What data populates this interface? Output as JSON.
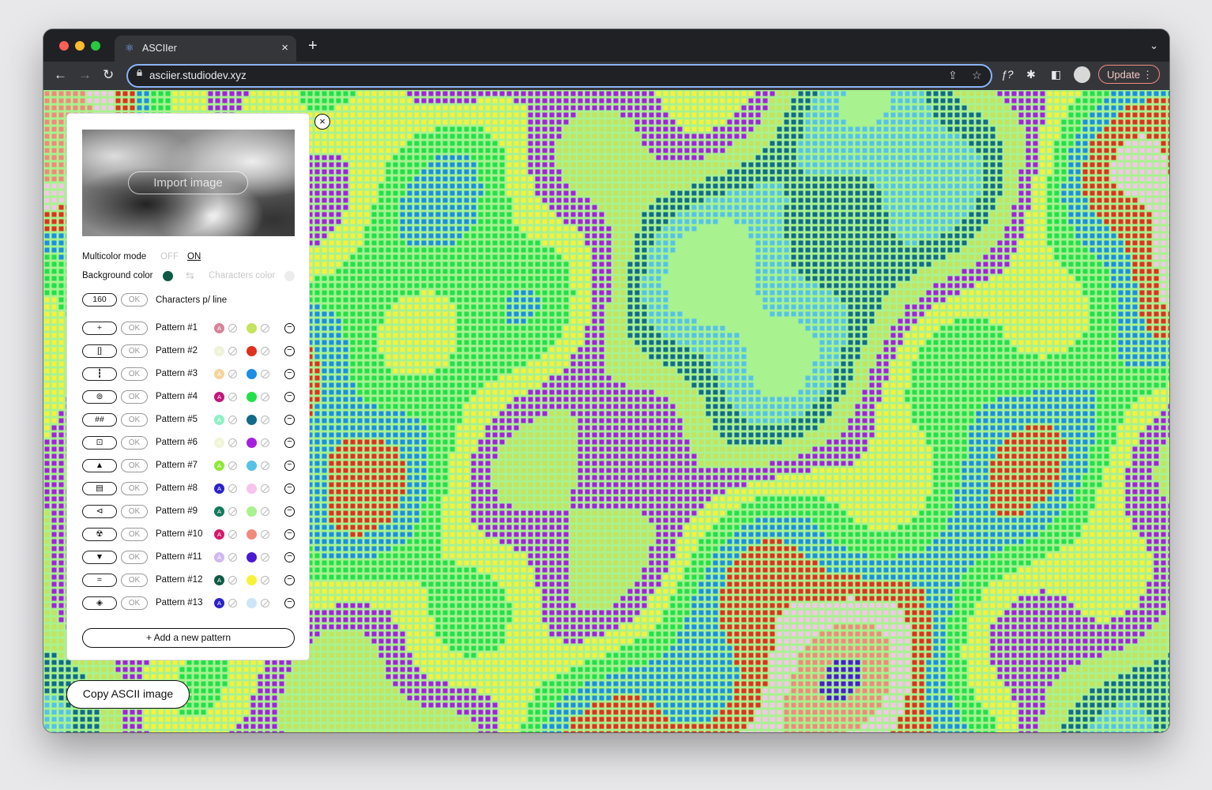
{
  "browser": {
    "tab_title": "ASCIIer",
    "url": "asciier.studiodev.xyz",
    "update_label": "Update",
    "new_tab": "+",
    "tab_close": "×"
  },
  "panel": {
    "import_label": "Import image",
    "multicolor_label": "Multicolor mode",
    "multicolor_off": "OFF",
    "multicolor_on": "ON",
    "background_label": "Background color",
    "background_color": "#0f5a45",
    "characters_color_label": "Characters color",
    "chars_per_line_value": "160",
    "ok_label": "OK",
    "chars_per_line_label": "Characters p/ line",
    "add_pattern_label": "+ Add a new pattern",
    "close_label": "×",
    "patterns": [
      {
        "char": "+",
        "name": "Pattern #1",
        "swatch_a": "#d4839b",
        "color": "#c5e35c"
      },
      {
        "char": "[]",
        "name": "Pattern #2",
        "swatch_a": "#eef2d6",
        "color": "#e0301e"
      },
      {
        "char": "┇",
        "name": "Pattern #3",
        "swatch_a": "#f5d49d",
        "color": "#1a8fe3"
      },
      {
        "char": "⊚",
        "name": "Pattern #4",
        "swatch_a": "#c2187a",
        "color": "#22e04a"
      },
      {
        "char": "##",
        "name": "Pattern #5",
        "swatch_a": "#8ef0c4",
        "color": "#126a8a"
      },
      {
        "char": "⊡",
        "name": "Pattern #6",
        "swatch_a": "#f0f5d5",
        "color": "#a51fe0"
      },
      {
        "char": "▲",
        "name": "Pattern #7",
        "swatch_a": "#8fe838",
        "color": "#55c2e8"
      },
      {
        "char": "▤",
        "name": "Pattern #8",
        "swatch_a": "#2a24c8",
        "color": "#f7c4ec"
      },
      {
        "char": "⊲",
        "name": "Pattern #9",
        "swatch_a": "#127a5a",
        "color": "#a8f290"
      },
      {
        "char": "☢",
        "name": "Pattern #10",
        "swatch_a": "#d6186a",
        "color": "#f08a7a"
      },
      {
        "char": "▼",
        "name": "Pattern #11",
        "swatch_a": "#d0b8ec",
        "color": "#4a1ad0"
      },
      {
        "char": "=",
        "name": "Pattern #12",
        "swatch_a": "#0f5a45",
        "color": "#f7f13a"
      },
      {
        "char": "◈",
        "name": "Pattern #13",
        "swatch_a": "#2a24c8",
        "color": "#cce6f7"
      }
    ]
  },
  "copy_label": "Copy ASCII image",
  "swatch_letter": "A"
}
